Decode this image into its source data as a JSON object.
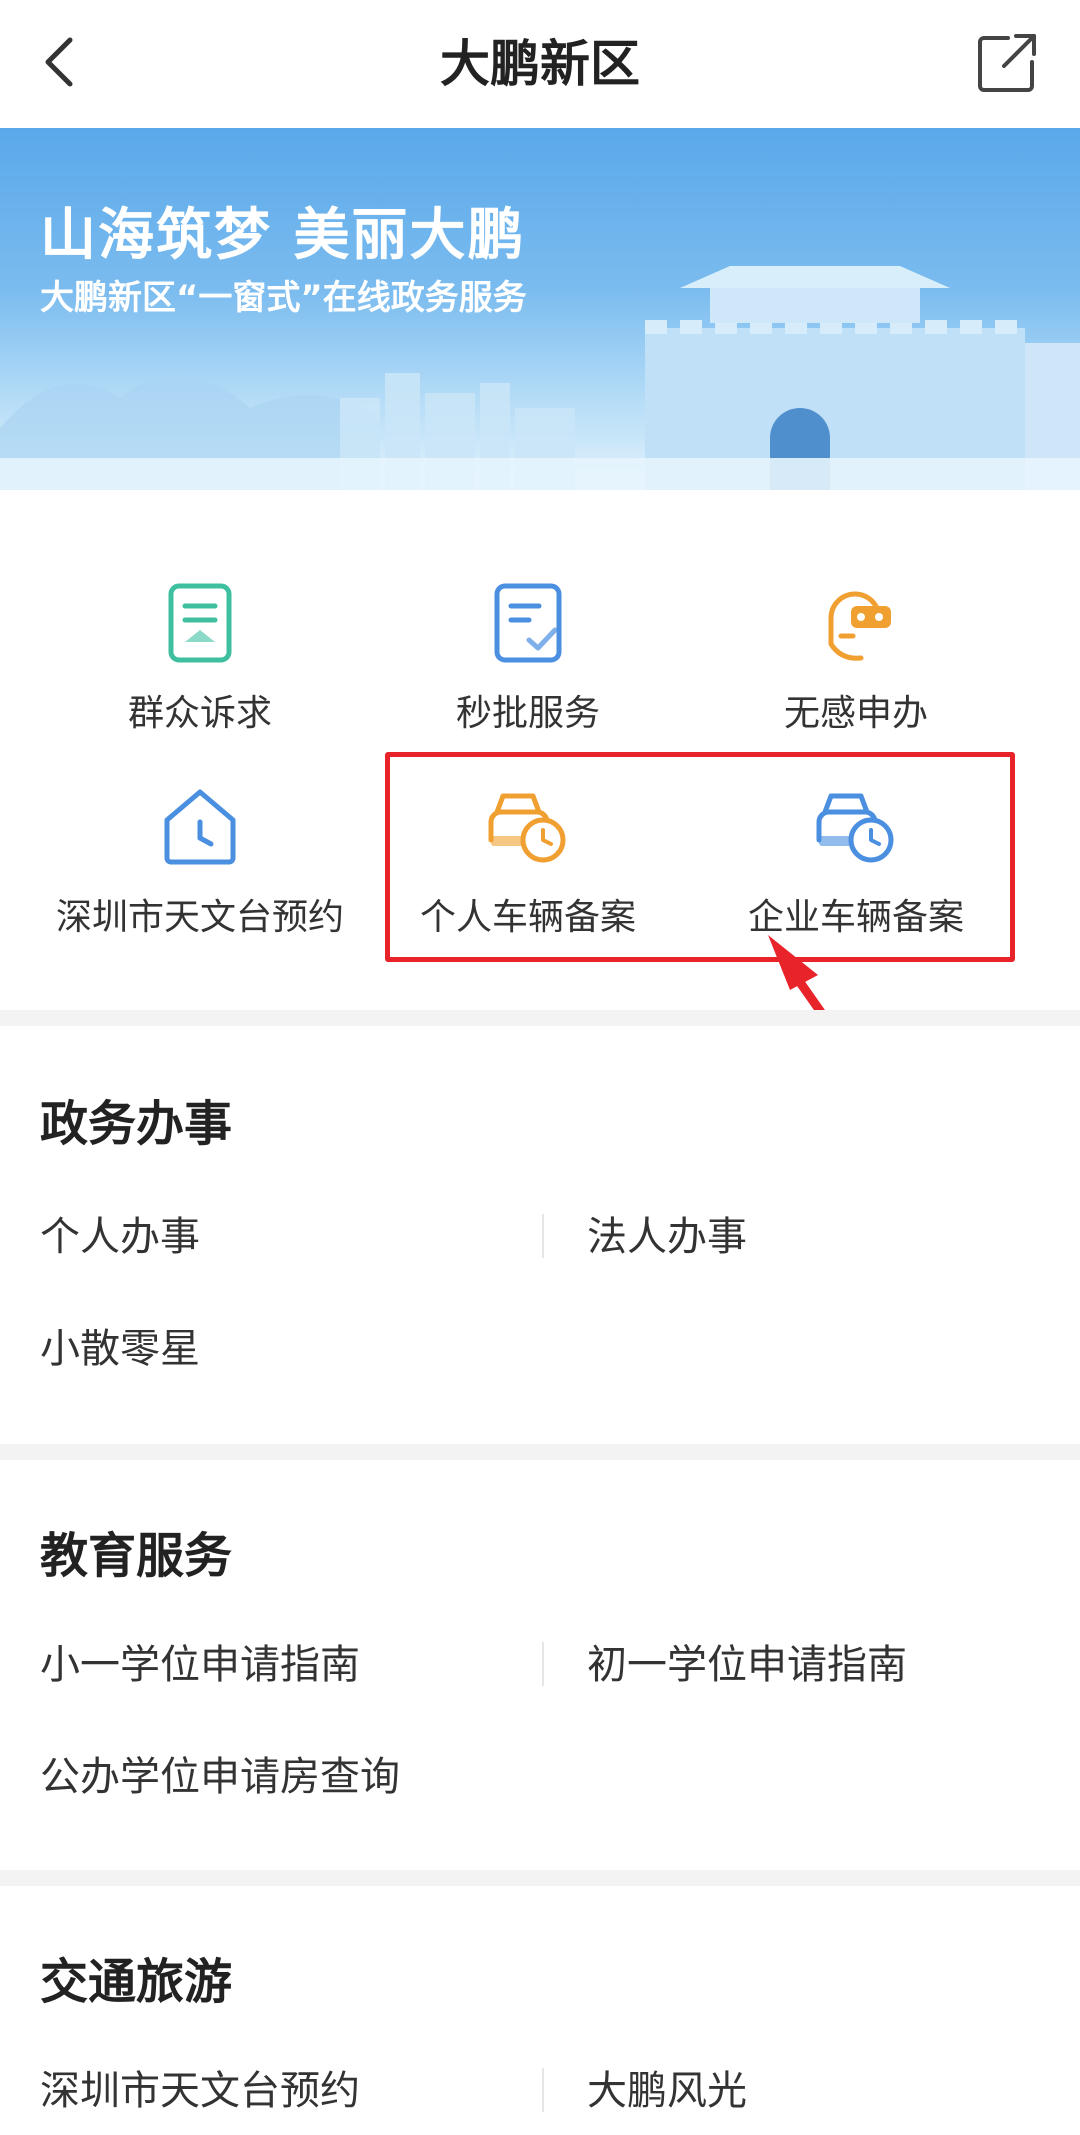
{
  "nav": {
    "title": "大鹏新区"
  },
  "banner": {
    "title": "山海筑梦 美丽大鹏",
    "subtitle": "大鹏新区“一窗式”在线政务服务"
  },
  "grid": {
    "items": [
      {
        "label": "群众诉求",
        "icon": "document-list-icon",
        "color": "#3dbfa0"
      },
      {
        "label": "秒批服务",
        "icon": "document-check-icon",
        "color": "#4a8fe0"
      },
      {
        "label": "无感申办",
        "icon": "face-scan-icon",
        "color": "#f0a030"
      },
      {
        "label": "深圳市天文台预约",
        "icon": "house-clock-icon",
        "color": "#4a8fe0"
      },
      {
        "label": "个人车辆备案",
        "icon": "car-clock-icon",
        "color": "#f0a030"
      },
      {
        "label": "企业车辆备案",
        "icon": "car-clock-icon",
        "color": "#4a8fe0"
      }
    ]
  },
  "sections": [
    {
      "title": "政务办事",
      "links": [
        "个人办事",
        "法人办事",
        "小散零星"
      ]
    },
    {
      "title": "教育服务",
      "links": [
        "小一学位申请指南",
        "初一学位申请指南",
        "公办学位申请房查询"
      ]
    },
    {
      "title": "交通旅游",
      "links": [
        "深圳市天文台预约",
        "大鹏风光"
      ]
    }
  ],
  "colors": {
    "highlight": "#e8232a",
    "green": "#3dbfa0",
    "blue": "#4a8fe0",
    "orange": "#f0a030"
  }
}
